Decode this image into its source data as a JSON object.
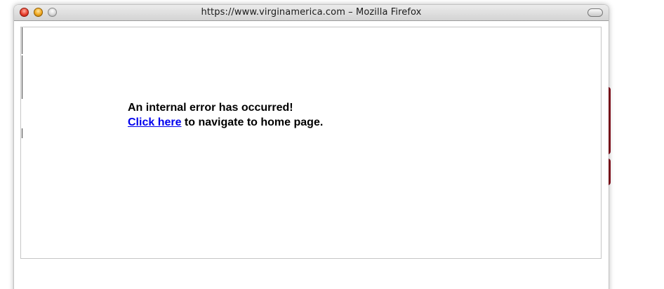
{
  "window": {
    "title": "https://www.virginamerica.com – Mozilla Firefox"
  },
  "page": {
    "error_heading": "An internal error has occurred!",
    "link_text": "Click here",
    "link_suffix": " to navigate to home page."
  },
  "colors": {
    "link": "#0000ee",
    "background_accent": "#8b0f1e"
  },
  "icons": {
    "close": "close-button-icon",
    "minimize": "minimize-button-icon",
    "zoom": "zoom-button-icon",
    "toolbar_toggle": "toolbar-toggle-icon"
  }
}
